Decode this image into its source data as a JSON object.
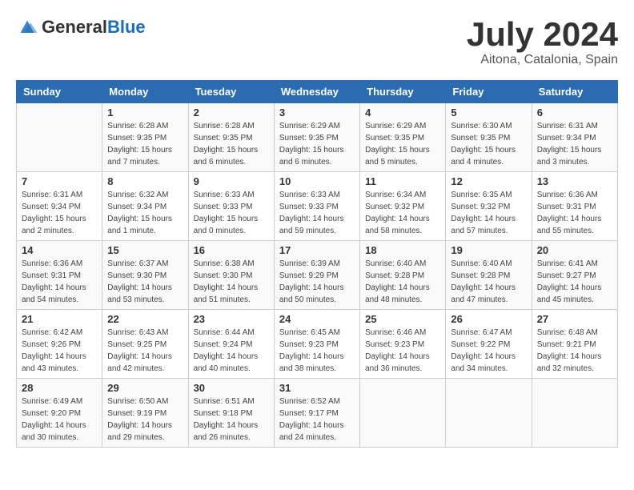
{
  "header": {
    "logo_general": "General",
    "logo_blue": "Blue",
    "month_title": "July 2024",
    "location": "Aitona, Catalonia, Spain"
  },
  "columns": [
    "Sunday",
    "Monday",
    "Tuesday",
    "Wednesday",
    "Thursday",
    "Friday",
    "Saturday"
  ],
  "weeks": [
    [
      {
        "day": "",
        "sunrise": "",
        "sunset": "",
        "daylight": ""
      },
      {
        "day": "1",
        "sunrise": "Sunrise: 6:28 AM",
        "sunset": "Sunset: 9:35 PM",
        "daylight": "Daylight: 15 hours and 7 minutes."
      },
      {
        "day": "2",
        "sunrise": "Sunrise: 6:28 AM",
        "sunset": "Sunset: 9:35 PM",
        "daylight": "Daylight: 15 hours and 6 minutes."
      },
      {
        "day": "3",
        "sunrise": "Sunrise: 6:29 AM",
        "sunset": "Sunset: 9:35 PM",
        "daylight": "Daylight: 15 hours and 6 minutes."
      },
      {
        "day": "4",
        "sunrise": "Sunrise: 6:29 AM",
        "sunset": "Sunset: 9:35 PM",
        "daylight": "Daylight: 15 hours and 5 minutes."
      },
      {
        "day": "5",
        "sunrise": "Sunrise: 6:30 AM",
        "sunset": "Sunset: 9:35 PM",
        "daylight": "Daylight: 15 hours and 4 minutes."
      },
      {
        "day": "6",
        "sunrise": "Sunrise: 6:31 AM",
        "sunset": "Sunset: 9:34 PM",
        "daylight": "Daylight: 15 hours and 3 minutes."
      }
    ],
    [
      {
        "day": "7",
        "sunrise": "Sunrise: 6:31 AM",
        "sunset": "Sunset: 9:34 PM",
        "daylight": "Daylight: 15 hours and 2 minutes."
      },
      {
        "day": "8",
        "sunrise": "Sunrise: 6:32 AM",
        "sunset": "Sunset: 9:34 PM",
        "daylight": "Daylight: 15 hours and 1 minute."
      },
      {
        "day": "9",
        "sunrise": "Sunrise: 6:33 AM",
        "sunset": "Sunset: 9:33 PM",
        "daylight": "Daylight: 15 hours and 0 minutes."
      },
      {
        "day": "10",
        "sunrise": "Sunrise: 6:33 AM",
        "sunset": "Sunset: 9:33 PM",
        "daylight": "Daylight: 14 hours and 59 minutes."
      },
      {
        "day": "11",
        "sunrise": "Sunrise: 6:34 AM",
        "sunset": "Sunset: 9:32 PM",
        "daylight": "Daylight: 14 hours and 58 minutes."
      },
      {
        "day": "12",
        "sunrise": "Sunrise: 6:35 AM",
        "sunset": "Sunset: 9:32 PM",
        "daylight": "Daylight: 14 hours and 57 minutes."
      },
      {
        "day": "13",
        "sunrise": "Sunrise: 6:36 AM",
        "sunset": "Sunset: 9:31 PM",
        "daylight": "Daylight: 14 hours and 55 minutes."
      }
    ],
    [
      {
        "day": "14",
        "sunrise": "Sunrise: 6:36 AM",
        "sunset": "Sunset: 9:31 PM",
        "daylight": "Daylight: 14 hours and 54 minutes."
      },
      {
        "day": "15",
        "sunrise": "Sunrise: 6:37 AM",
        "sunset": "Sunset: 9:30 PM",
        "daylight": "Daylight: 14 hours and 53 minutes."
      },
      {
        "day": "16",
        "sunrise": "Sunrise: 6:38 AM",
        "sunset": "Sunset: 9:30 PM",
        "daylight": "Daylight: 14 hours and 51 minutes."
      },
      {
        "day": "17",
        "sunrise": "Sunrise: 6:39 AM",
        "sunset": "Sunset: 9:29 PM",
        "daylight": "Daylight: 14 hours and 50 minutes."
      },
      {
        "day": "18",
        "sunrise": "Sunrise: 6:40 AM",
        "sunset": "Sunset: 9:28 PM",
        "daylight": "Daylight: 14 hours and 48 minutes."
      },
      {
        "day": "19",
        "sunrise": "Sunrise: 6:40 AM",
        "sunset": "Sunset: 9:28 PM",
        "daylight": "Daylight: 14 hours and 47 minutes."
      },
      {
        "day": "20",
        "sunrise": "Sunrise: 6:41 AM",
        "sunset": "Sunset: 9:27 PM",
        "daylight": "Daylight: 14 hours and 45 minutes."
      }
    ],
    [
      {
        "day": "21",
        "sunrise": "Sunrise: 6:42 AM",
        "sunset": "Sunset: 9:26 PM",
        "daylight": "Daylight: 14 hours and 43 minutes."
      },
      {
        "day": "22",
        "sunrise": "Sunrise: 6:43 AM",
        "sunset": "Sunset: 9:25 PM",
        "daylight": "Daylight: 14 hours and 42 minutes."
      },
      {
        "day": "23",
        "sunrise": "Sunrise: 6:44 AM",
        "sunset": "Sunset: 9:24 PM",
        "daylight": "Daylight: 14 hours and 40 minutes."
      },
      {
        "day": "24",
        "sunrise": "Sunrise: 6:45 AM",
        "sunset": "Sunset: 9:23 PM",
        "daylight": "Daylight: 14 hours and 38 minutes."
      },
      {
        "day": "25",
        "sunrise": "Sunrise: 6:46 AM",
        "sunset": "Sunset: 9:23 PM",
        "daylight": "Daylight: 14 hours and 36 minutes."
      },
      {
        "day": "26",
        "sunrise": "Sunrise: 6:47 AM",
        "sunset": "Sunset: 9:22 PM",
        "daylight": "Daylight: 14 hours and 34 minutes."
      },
      {
        "day": "27",
        "sunrise": "Sunrise: 6:48 AM",
        "sunset": "Sunset: 9:21 PM",
        "daylight": "Daylight: 14 hours and 32 minutes."
      }
    ],
    [
      {
        "day": "28",
        "sunrise": "Sunrise: 6:49 AM",
        "sunset": "Sunset: 9:20 PM",
        "daylight": "Daylight: 14 hours and 30 minutes."
      },
      {
        "day": "29",
        "sunrise": "Sunrise: 6:50 AM",
        "sunset": "Sunset: 9:19 PM",
        "daylight": "Daylight: 14 hours and 29 minutes."
      },
      {
        "day": "30",
        "sunrise": "Sunrise: 6:51 AM",
        "sunset": "Sunset: 9:18 PM",
        "daylight": "Daylight: 14 hours and 26 minutes."
      },
      {
        "day": "31",
        "sunrise": "Sunrise: 6:52 AM",
        "sunset": "Sunset: 9:17 PM",
        "daylight": "Daylight: 14 hours and 24 minutes."
      },
      {
        "day": "",
        "sunrise": "",
        "sunset": "",
        "daylight": ""
      },
      {
        "day": "",
        "sunrise": "",
        "sunset": "",
        "daylight": ""
      },
      {
        "day": "",
        "sunrise": "",
        "sunset": "",
        "daylight": ""
      }
    ]
  ]
}
